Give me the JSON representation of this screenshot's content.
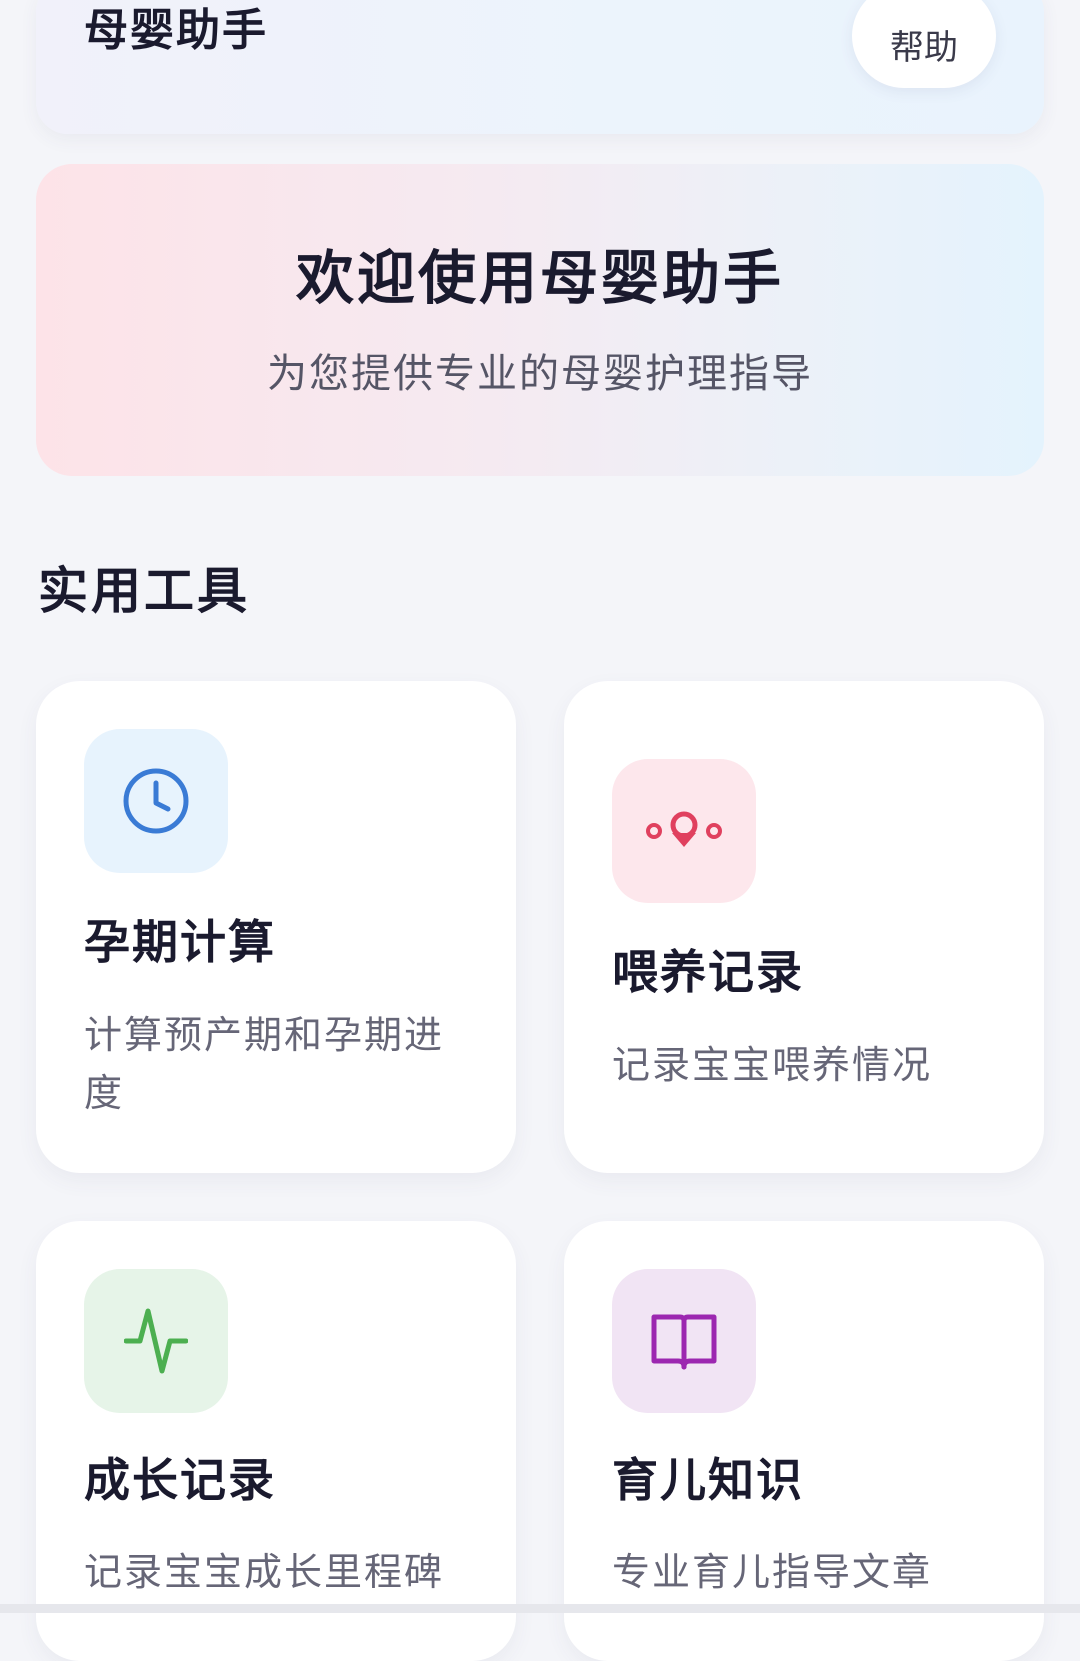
{
  "header": {
    "title": "母婴助手",
    "help_label": "帮助"
  },
  "welcome": {
    "title": "欢迎使用母婴助手",
    "subtitle": "为您提供专业的母婴护理指导"
  },
  "tools_section": {
    "title": "实用工具",
    "items": [
      {
        "name": "孕期计算",
        "description": "计算预产期和孕期进度",
        "icon": "clock-icon",
        "icon_color": "#3a7bd5",
        "icon_bg": "#e7f3fd"
      },
      {
        "name": "喂养记录",
        "description": "记录宝宝喂养情况",
        "icon": "feeding-icon",
        "icon_color": "#e0405e",
        "icon_bg": "#fde7ec"
      },
      {
        "name": "成长记录",
        "description": "记录宝宝成长里程碑",
        "icon": "activity-icon",
        "icon_color": "#4caf50",
        "icon_bg": "#e6f4e8"
      },
      {
        "name": "育儿知识",
        "description": "专业育儿指导文章",
        "icon": "book-icon",
        "icon_color": "#9c27b0",
        "icon_bg": "#f1e4f4"
      }
    ]
  }
}
